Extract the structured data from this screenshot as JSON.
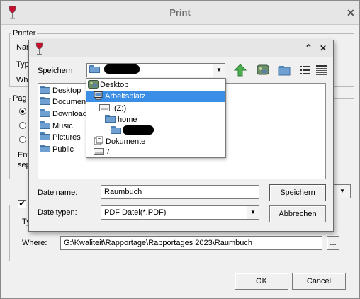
{
  "print_dialog": {
    "title": "Print",
    "printer_group": "Printer",
    "name_label": "Nam",
    "type_label": "Typ",
    "where_label": "Whe",
    "pages_group": "Pag",
    "enter_label": "Ent",
    "sep_label": "sep",
    "ty_label": "Ty",
    "where_row_label": "Where:",
    "where_value": "G:\\Kwaliteit\\Rapportage\\Rapportages 2023\\Raumbuch",
    "browse_label": "...",
    "ok_label": "OK",
    "cancel_label": "Cancel",
    "close_glyph": "✕"
  },
  "file_dialog": {
    "up_glyph": "⌃",
    "close_glyph": "✕",
    "speichern_in_label": "Speichern",
    "places": [
      {
        "label": "Desktop"
      },
      {
        "label": "Document"
      },
      {
        "label": "Downloads"
      },
      {
        "label": "Music"
      },
      {
        "label": "Pictures"
      },
      {
        "label": "Public"
      }
    ],
    "dropdown_items": {
      "desktop": "Desktop",
      "arbeitsplatz": "Arbeitsplatz",
      "z_drive": "(Z:)",
      "home": "home",
      "dokumente": "Dokumente",
      "root": "/"
    },
    "filename_label": "Dateiname:",
    "filename_value": "Raumbuch",
    "filetype_label": "Dateitypen:",
    "filetype_value": "PDF Datei(*.PDF)",
    "save_label": "Speichern",
    "cancel_label": "Abbrechen",
    "combo_arrow": "▼"
  }
}
